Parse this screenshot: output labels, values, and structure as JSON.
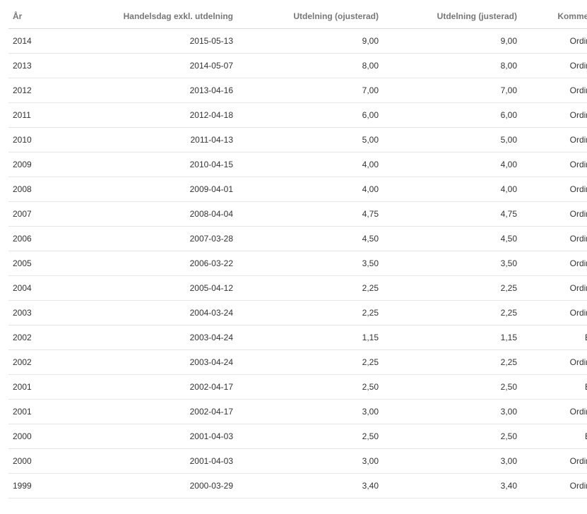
{
  "table": {
    "columns": [
      "År",
      "Handelsdag exkl. utdelning",
      "Utdelning (ojusterad)",
      "Utdelning (justerad)",
      "Kommentar"
    ],
    "rows": [
      [
        "2014",
        "2015-05-13",
        "9,00",
        "9,00",
        "Ordinarie"
      ],
      [
        "2013",
        "2014-05-07",
        "8,00",
        "8,00",
        "Ordinarie"
      ],
      [
        "2012",
        "2013-04-16",
        "7,00",
        "7,00",
        "Ordinarie"
      ],
      [
        "2011",
        "2012-04-18",
        "6,00",
        "6,00",
        "Ordinarie"
      ],
      [
        "2010",
        "2011-04-13",
        "5,00",
        "5,00",
        "Ordinarie"
      ],
      [
        "2009",
        "2010-04-15",
        "4,00",
        "4,00",
        "Ordinarie"
      ],
      [
        "2008",
        "2009-04-01",
        "4,00",
        "4,00",
        "Ordinarie"
      ],
      [
        "2007",
        "2008-04-04",
        "4,75",
        "4,75",
        "Ordinarie"
      ],
      [
        "2006",
        "2007-03-28",
        "4,50",
        "4,50",
        "Ordinarie"
      ],
      [
        "2005",
        "2006-03-22",
        "3,50",
        "3,50",
        "Ordinarie"
      ],
      [
        "2004",
        "2005-04-12",
        "2,25",
        "2,25",
        "Ordinarie"
      ],
      [
        "2003",
        "2004-03-24",
        "2,25",
        "2,25",
        "Ordinarie"
      ],
      [
        "2002",
        "2003-04-24",
        "1,15",
        "1,15",
        "Extra"
      ],
      [
        "2002",
        "2003-04-24",
        "2,25",
        "2,25",
        "Ordinarie"
      ],
      [
        "2001",
        "2002-04-17",
        "2,50",
        "2,50",
        "Extra"
      ],
      [
        "2001",
        "2002-04-17",
        "3,00",
        "3,00",
        "Ordinarie"
      ],
      [
        "2000",
        "2001-04-03",
        "2,50",
        "2,50",
        "Extra"
      ],
      [
        "2000",
        "2001-04-03",
        "3,00",
        "3,00",
        "Ordinarie"
      ],
      [
        "1999",
        "2000-03-29",
        "3,40",
        "3,40",
        "Ordinarie"
      ]
    ]
  },
  "colors": {
    "header_text": "#777777",
    "cell_text": "#333333",
    "row_divider": "#e6e6e6"
  }
}
